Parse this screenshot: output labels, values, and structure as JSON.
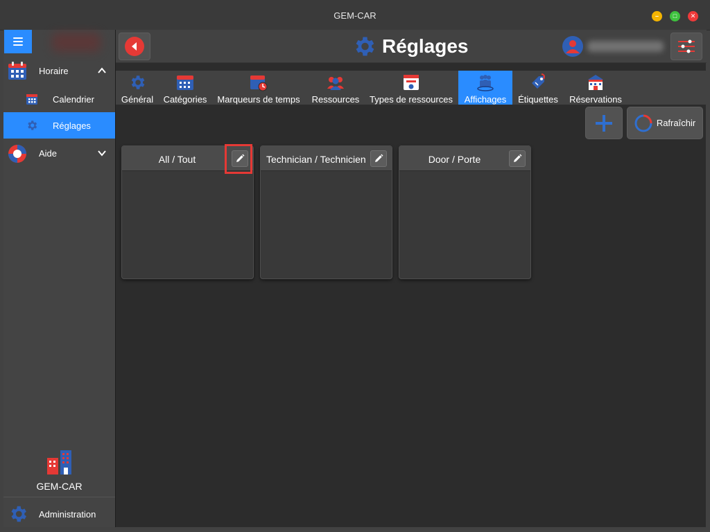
{
  "window": {
    "title": "GEM-CAR",
    "controls": {
      "minimize": "–",
      "maximize": "□",
      "close": "✕"
    }
  },
  "sidebar": {
    "menu_icon": "hamburger-icon",
    "items": [
      {
        "label": "Horaire",
        "icon": "calendar-grid-icon",
        "expanded": true
      },
      {
        "label": "Calendrier",
        "icon": "calendar-small-icon",
        "sub": true
      },
      {
        "label": "Réglages",
        "icon": "gear-icon",
        "sub": true,
        "active": true
      },
      {
        "label": "Aide",
        "icon": "lifebuoy-icon",
        "expanded": false
      }
    ],
    "company_label": "GEM-CAR",
    "admin_label": "Administration"
  },
  "header": {
    "title": "Réglages",
    "title_icon": "gear-icon",
    "back_icon": "back-arrow-icon",
    "settings_icon": "sliders-icon"
  },
  "tabs": [
    {
      "label": "Général",
      "icon": "gear-icon"
    },
    {
      "label": "Catégories",
      "icon": "calendar-icon"
    },
    {
      "label": "Marqueurs de temps",
      "icon": "calendar-clock-icon"
    },
    {
      "label": "Ressources",
      "icon": "people-icon"
    },
    {
      "label": "Types de ressources",
      "icon": "badge-icon"
    },
    {
      "label": "Affichages",
      "icon": "group-icon",
      "active": true
    },
    {
      "label": "Étiquettes",
      "icon": "tag-icon"
    },
    {
      "label": "Réservations",
      "icon": "building-icon"
    }
  ],
  "toolbar": {
    "add_icon": "plus-icon",
    "refresh_label": "Rafraîchir",
    "refresh_icon": "refresh-icon"
  },
  "cards": [
    {
      "title": "All / Tout",
      "edit_icon": "pencil-icon"
    },
    {
      "title": "Technician / Technicien",
      "edit_icon": "pencil-icon"
    },
    {
      "title": "Door / Porte",
      "edit_icon": "pencil-icon"
    }
  ],
  "colors": {
    "accent": "#2a8cff",
    "icon_blue": "#2f5fb5",
    "icon_red": "#e53935",
    "background": "#2c2c2c",
    "panel": "#424242"
  }
}
